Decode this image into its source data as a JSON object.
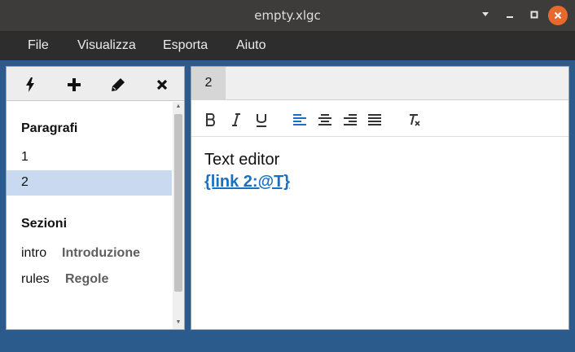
{
  "window": {
    "title": "empty.xlgc"
  },
  "menu": {
    "items": [
      "File",
      "Visualizza",
      "Esporta",
      "Aiuto"
    ]
  },
  "left": {
    "toolbar": [
      "lightning-icon",
      "plus-icon",
      "pencil-icon",
      "close-icon"
    ],
    "paragraphs_title": "Paragrafi",
    "paragraphs": [
      "1",
      "2"
    ],
    "selected_paragraph": "2",
    "sections_title": "Sezioni",
    "sections": [
      {
        "id": "intro",
        "name": "Introduzione"
      },
      {
        "id": "rules",
        "name": "Regole"
      }
    ]
  },
  "editor": {
    "tab": "2",
    "format_buttons": [
      "bold-icon",
      "italic-icon",
      "underline-icon",
      "align-left-icon",
      "align-center-icon",
      "align-right-icon",
      "justify-icon",
      "clear-format-icon"
    ],
    "active_format": "align-left-icon",
    "accent_color": "#1a6fc0",
    "text_line": "Text editor",
    "link_text": "{link 2:@T}"
  }
}
